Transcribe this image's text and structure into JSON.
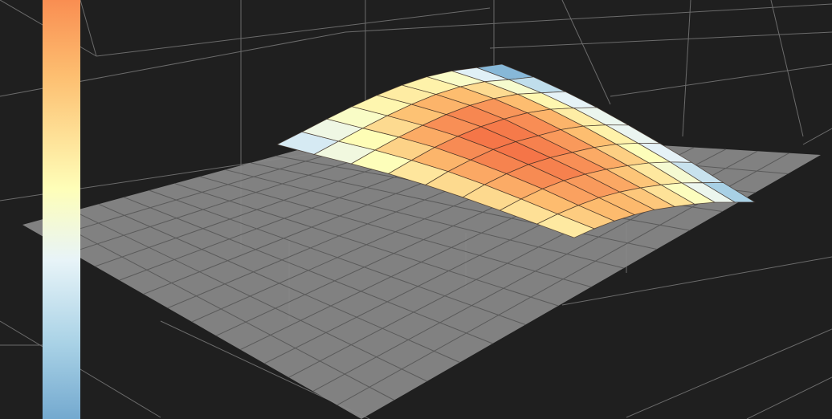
{
  "chart_data": {
    "type": "surface3d",
    "title": "",
    "xlabel": "",
    "ylabel": "",
    "zlabel": "",
    "grid": true,
    "x": [
      0,
      1,
      2,
      3,
      4,
      5,
      6,
      7,
      8,
      9
    ],
    "y": [
      0,
      1,
      2,
      3,
      4,
      5,
      6,
      7,
      8
    ],
    "z": [
      [
        0.0,
        0.12,
        0.25,
        0.36,
        0.44,
        0.48,
        0.46,
        0.36,
        0.18,
        0.0
      ],
      [
        0.1,
        0.26,
        0.42,
        0.56,
        0.66,
        0.72,
        0.7,
        0.6,
        0.4,
        0.22
      ],
      [
        0.22,
        0.42,
        0.6,
        0.74,
        0.85,
        0.9,
        0.88,
        0.78,
        0.58,
        0.38
      ],
      [
        0.32,
        0.54,
        0.74,
        0.88,
        0.97,
        1.0,
        0.98,
        0.88,
        0.7,
        0.5
      ],
      [
        0.38,
        0.62,
        0.8,
        0.94,
        1.0,
        1.0,
        1.0,
        0.92,
        0.76,
        0.56
      ],
      [
        0.4,
        0.64,
        0.82,
        0.95,
        1.0,
        1.0,
        0.99,
        0.92,
        0.78,
        0.6
      ],
      [
        0.4,
        0.62,
        0.8,
        0.92,
        0.98,
        0.99,
        0.96,
        0.9,
        0.78,
        0.62
      ],
      [
        0.38,
        0.58,
        0.74,
        0.86,
        0.92,
        0.93,
        0.9,
        0.84,
        0.72,
        0.6
      ],
      [
        0.36,
        0.55,
        0.7,
        0.8,
        0.86,
        0.86,
        0.84,
        0.8,
        0.7,
        0.6
      ]
    ],
    "colorscale": [
      "#4a6fb5",
      "#8fc2dd",
      "#e8f4f8",
      "#fefeb8",
      "#fdbe70",
      "#f46d43",
      "#b0091f"
    ],
    "floor_color": "#8a8a8a",
    "background": "#1f1f1f",
    "colorbar": {
      "position": "left"
    }
  }
}
